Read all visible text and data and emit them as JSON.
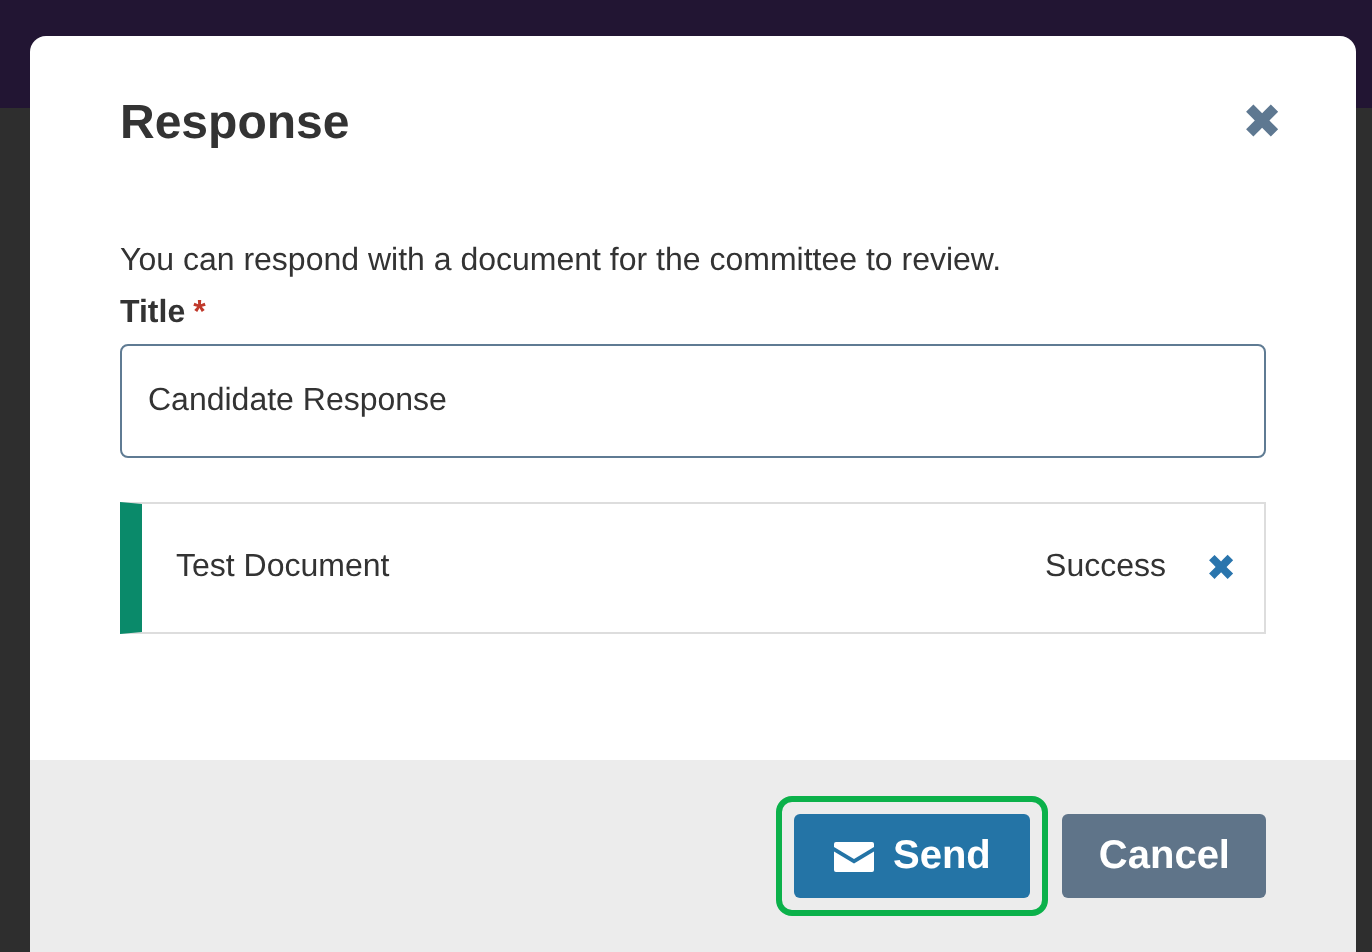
{
  "dialog": {
    "title": "Response",
    "close_icon": "✖",
    "description": "You can respond with a document for the committee to review.",
    "field": {
      "label": "Title",
      "required_mark": "*",
      "value": "Candidate Response"
    },
    "attachments": [
      {
        "name": "Test Document",
        "status": "Success",
        "remove_icon": "✖"
      }
    ],
    "buttons": [
      {
        "kind": "primary",
        "label": "Send",
        "highlighted": true
      },
      {
        "kind": "secondary",
        "label": "Cancel",
        "highlighted": false
      }
    ]
  }
}
